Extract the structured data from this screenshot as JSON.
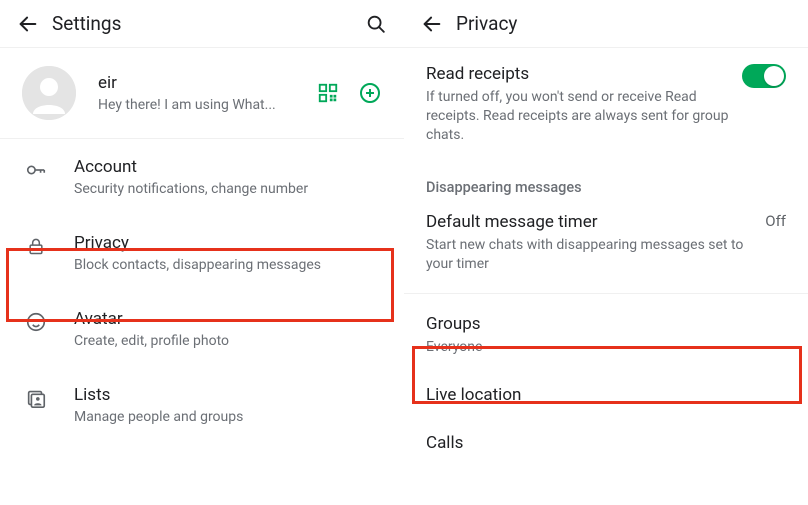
{
  "left": {
    "title": "Settings",
    "profile": {
      "name": "eir",
      "status": "Hey there! I am using What..."
    },
    "items": [
      {
        "label": "Account",
        "sub": "Security notifications, change number"
      },
      {
        "label": "Privacy",
        "sub": "Block contacts, disappearing messages"
      },
      {
        "label": "Avatar",
        "sub": "Create, edit, profile photo"
      },
      {
        "label": "Lists",
        "sub": "Manage people and groups"
      }
    ]
  },
  "right": {
    "title": "Privacy",
    "readReceipts": {
      "label": "Read receipts",
      "desc": "If turned off, you won't send or receive Read receipts. Read receipts are always sent for group chats.",
      "value": true
    },
    "disappearing": {
      "sectionLabel": "Disappearing messages",
      "timerLabel": "Default message timer",
      "timerDesc": "Start new chats with disappearing messages set to your timer",
      "timerValue": "Off"
    },
    "groups": {
      "label": "Groups",
      "value": "Everyone"
    },
    "liveLocation": {
      "label": "Live location"
    },
    "calls": {
      "label": "Calls"
    }
  }
}
